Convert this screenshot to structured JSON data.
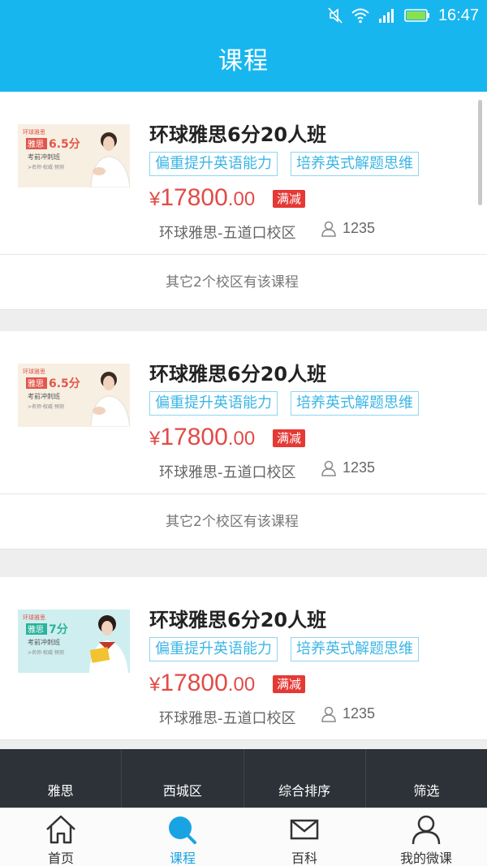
{
  "status_bar": {
    "time": "16:47"
  },
  "page_title": "课程",
  "courses": [
    {
      "title": "环球雅思6分20人班",
      "tags": [
        "偏重提升英语能力",
        "培养英式解题思维"
      ],
      "price": {
        "currency": "¥",
        "integer": "17800",
        "decimal": ".00"
      },
      "badge": "满减",
      "campus": "环球雅思-五道口校区",
      "enrolled": "1235",
      "other_campuses": "其它2个校区有该课程",
      "thumb": {
        "brand": "环球雅思",
        "subject": "雅思",
        "score": "6.5分",
        "subtitle": "考前冲刺班",
        "note": ">名师·权威·预测"
      }
    },
    {
      "title": "环球雅思6分20人班",
      "tags": [
        "偏重提升英语能力",
        "培养英式解题思维"
      ],
      "price": {
        "currency": "¥",
        "integer": "17800",
        "decimal": ".00"
      },
      "badge": "满减",
      "campus": "环球雅思-五道口校区",
      "enrolled": "1235",
      "other_campuses": "其它2个校区有该课程",
      "thumb": {
        "brand": "环球雅思",
        "subject": "雅思",
        "score": "6.5分",
        "subtitle": "考前冲刺班",
        "note": ">名师·权威·预测"
      }
    },
    {
      "title": "环球雅思6分20人班",
      "tags": [
        "偏重提升英语能力",
        "培养英式解题思维"
      ],
      "price": {
        "currency": "¥",
        "integer": "17800",
        "decimal": ".00"
      },
      "badge": "满减",
      "campus": "环球雅思-五道口校区",
      "enrolled": "1235",
      "thumb": {
        "brand": "环球雅思",
        "subject": "雅思",
        "score": "7分",
        "subtitle": "考前冲刺班",
        "note": ">名师·权威·预测"
      }
    }
  ],
  "filters": [
    "雅思",
    "西城区",
    "综合排序",
    "筛选"
  ],
  "tabs": [
    {
      "label": "首页",
      "icon": "home-icon"
    },
    {
      "label": "课程",
      "icon": "search-icon"
    },
    {
      "label": "百科",
      "icon": "mail-icon"
    },
    {
      "label": "我的微课",
      "icon": "user-icon"
    }
  ],
  "colors": {
    "header": "#18b6ef",
    "accent": "#1aa3e2",
    "price": "#e24b47",
    "badge": "#e53935",
    "tag_border": "#8fd6f2",
    "filter_bar": "#2d3238"
  }
}
